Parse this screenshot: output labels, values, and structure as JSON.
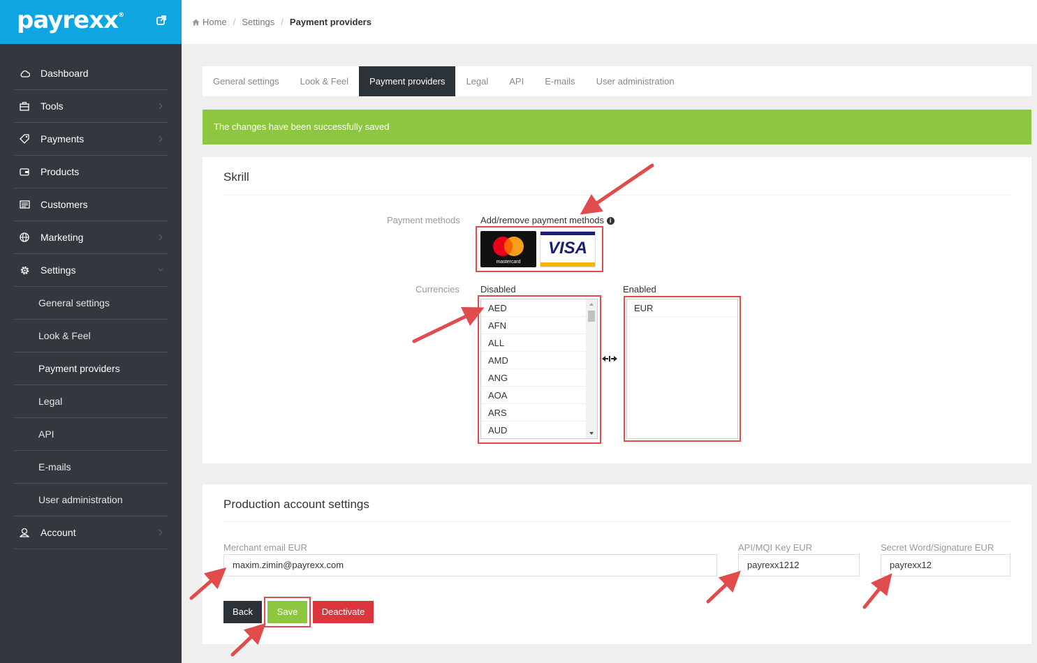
{
  "brand": {
    "logo": "payrexx",
    "tm": "®"
  },
  "sidebar": {
    "items": [
      {
        "label": "Dashboard",
        "icon": "cloud-icon",
        "has_chevron": false
      },
      {
        "label": "Tools",
        "icon": "briefcase-icon",
        "has_chevron": true
      },
      {
        "label": "Payments",
        "icon": "tag-icon",
        "has_chevron": true
      },
      {
        "label": "Products",
        "icon": "wallet-icon",
        "has_chevron": false
      },
      {
        "label": "Customers",
        "icon": "id-card-icon",
        "has_chevron": false
      },
      {
        "label": "Marketing",
        "icon": "globe-icon",
        "has_chevron": true
      },
      {
        "label": "Settings",
        "icon": "gear-icon",
        "has_chevron": true
      }
    ],
    "sub_items": [
      {
        "label": "General settings"
      },
      {
        "label": "Look & Feel"
      },
      {
        "label": "Payment providers"
      },
      {
        "label": "Legal"
      },
      {
        "label": "API"
      },
      {
        "label": "E-mails"
      },
      {
        "label": "User administration"
      }
    ],
    "account": {
      "label": "Account",
      "icon": "user-icon"
    }
  },
  "breadcrumb": {
    "home": "Home",
    "settings": "Settings",
    "current": "Payment providers"
  },
  "tabs": [
    {
      "label": "General settings"
    },
    {
      "label": "Look & Feel"
    },
    {
      "label": "Payment providers"
    },
    {
      "label": "Legal"
    },
    {
      "label": "API"
    },
    {
      "label": "E-mails"
    },
    {
      "label": "User administration"
    }
  ],
  "alert": {
    "text": "The changes have been successfully saved"
  },
  "skrill": {
    "title": "Skrill",
    "payment_methods_label": "Payment methods",
    "add_remove_label": "Add/remove payment methods",
    "cards": {
      "mastercard": "mastercard",
      "visa": "VISA"
    },
    "currencies_label": "Currencies",
    "disabled_label": "Disabled",
    "enabled_label": "Enabled",
    "disabled_options": [
      "AED",
      "AFN",
      "ALL",
      "AMD",
      "ANG",
      "AOA",
      "ARS",
      "AUD"
    ],
    "enabled_options": [
      "EUR"
    ],
    "transfer_icon": "transfer-arrows-icon"
  },
  "production": {
    "title": "Production account settings",
    "merchant_email_label": "Merchant email EUR",
    "merchant_email_value": "maxim.zimin@payrexx.com",
    "api_key_label": "API/MQI Key EUR",
    "api_key_value": "payrexx1212",
    "secret_label": "Secret Word/Signature EUR",
    "secret_value": "payrexx12"
  },
  "buttons": {
    "back": "Back",
    "save": "Save",
    "deactivate": "Deactivate"
  },
  "colors": {
    "brand": "#0ea5e0",
    "sidebar": "#32383e",
    "success": "#8dc63f",
    "danger": "#d9363e",
    "annotation": "#e04b4b"
  }
}
